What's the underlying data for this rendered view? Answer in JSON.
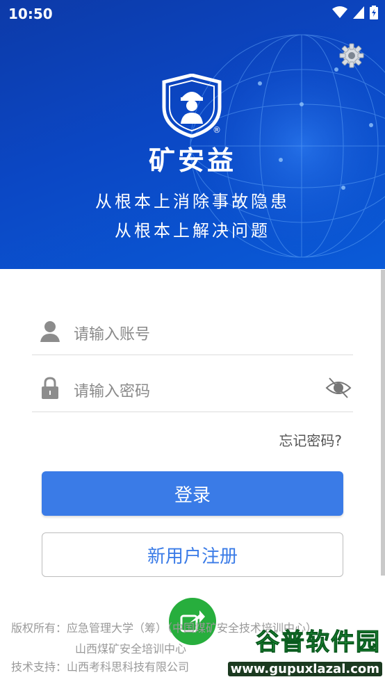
{
  "status_bar": {
    "time": "10:50"
  },
  "header": {
    "brand": "矿安益",
    "registered_mark": "®",
    "slogan_line1": "从根本上消除事故隐患",
    "slogan_line2": "从根本上解决问题"
  },
  "login": {
    "account_placeholder": "请输入账号",
    "password_placeholder": "请输入密码",
    "forgot_password": "忘记密码?",
    "login_button": "登录",
    "register_button": "新用户注册"
  },
  "footer": {
    "copyright": "版权所有：应急管理大学（筹）（中国煤矿安全技术培训中心）",
    "copyright_line2": "山西煤矿安全培训中心",
    "tech_support": "技术支持：山西考科思科技有限公司"
  },
  "watermark": {
    "title": "谷普软件园",
    "url": "www.gupuxlazal.com"
  },
  "colors": {
    "header_blue": "#0b47c4",
    "primary_button": "#3a7be7",
    "fab_green": "#27ae3d"
  },
  "icons": [
    "signal-icon",
    "wifi-icon",
    "battery-icon",
    "settings-gear-icon",
    "shield-logo-icon",
    "user-icon",
    "lock-icon",
    "eye-off-icon",
    "share-icon"
  ]
}
